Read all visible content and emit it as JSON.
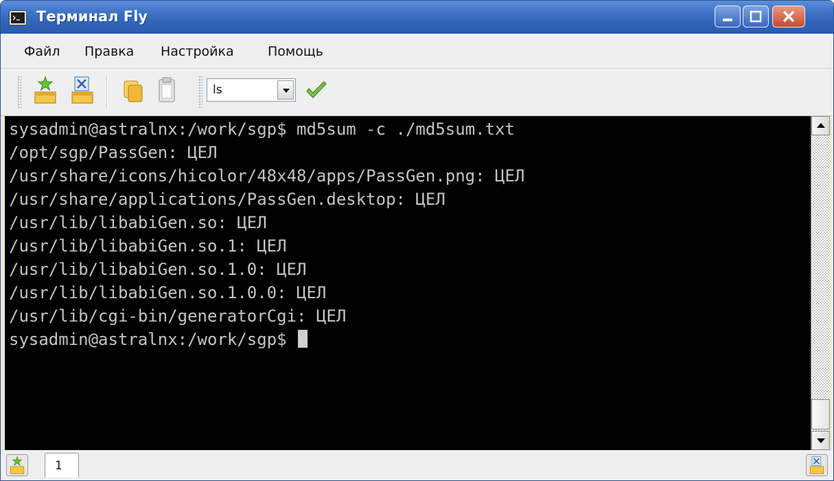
{
  "window": {
    "title": "Терминал Fly",
    "minimize_label": "minimize",
    "maximize_label": "maximize",
    "close_label": "close"
  },
  "menu": [
    {
      "label": "Файл"
    },
    {
      "label": "Правка"
    },
    {
      "label": "Настройка"
    },
    {
      "label": "Помощь"
    }
  ],
  "toolbar": {
    "new_tab_icon": "new-tab-icon",
    "close_tab_icon": "close-tab-icon",
    "copy_icon": "copy-icon",
    "paste_icon": "paste-icon",
    "command_value": "ls",
    "run_icon": "checkmark-icon"
  },
  "terminal": {
    "lines": [
      "sysadmin@astralnx:/work/sgp$ md5sum -c ./md5sum.txt",
      "/opt/sgp/PassGen: ЦЕЛ",
      "/usr/share/icons/hicolor/48x48/apps/PassGen.png: ЦЕЛ",
      "/usr/share/applications/PassGen.desktop: ЦЕЛ",
      "/usr/lib/libabiGen.so: ЦЕЛ",
      "/usr/lib/libabiGen.so.1: ЦЕЛ",
      "/usr/lib/libabiGen.so.1.0: ЦЕЛ",
      "/usr/lib/libabiGen.so.1.0.0: ЦЕЛ",
      "/usr/lib/cgi-bin/generatorCgi: ЦЕЛ"
    ],
    "prompt": "sysadmin@astralnx:/work/sgp$ ",
    "scroll_position": 1.0
  },
  "tabs": [
    {
      "label": "1"
    }
  ],
  "colors": {
    "titlebar": "#2e63b8",
    "terminal_bg": "#000000",
    "terminal_fg": "#c4c4c4",
    "chrome_bg": "#efefef"
  }
}
